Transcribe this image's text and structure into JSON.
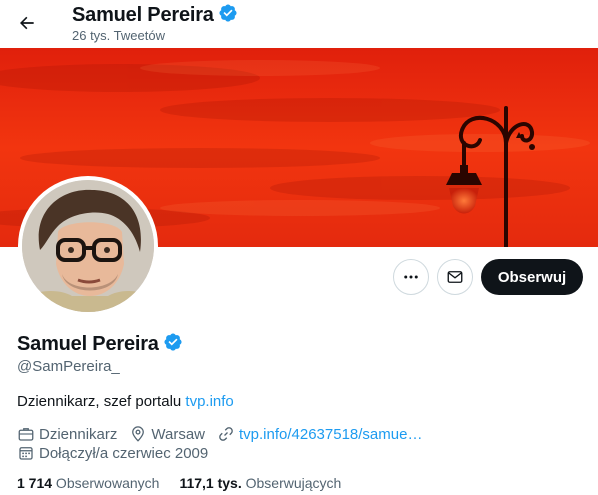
{
  "header": {
    "name": "Samuel Pereira",
    "tweet_count": "26 tys. Tweetów"
  },
  "profile": {
    "display_name": "Samuel Pereira",
    "handle": "@SamPereira_",
    "bio_text": "Dziennikarz, szef portalu ",
    "bio_link": "tvp.info",
    "profession": "Dziennikarz",
    "location": "Warsaw",
    "website": "tvp.info/42637518/samue…",
    "joined": "Dołączył/a czerwiec 2009"
  },
  "actions": {
    "follow_label": "Obserwuj"
  },
  "stats": {
    "following_count": "1 714",
    "following_label": " Obserwowanych",
    "followers_count": "117,1 tys.",
    "followers_label": " Obserwujących"
  },
  "colors": {
    "accent": "#1d9bf0",
    "banner": "#e8260f",
    "text": "#0f1419",
    "muted": "#536471"
  },
  "icons": {
    "back": "arrow-left-icon",
    "verified": "verified-badge-icon",
    "more": "more-dots-icon",
    "message": "envelope-icon",
    "profession": "briefcase-icon",
    "location": "location-pin-icon",
    "website": "link-icon",
    "joined": "calendar-icon"
  }
}
